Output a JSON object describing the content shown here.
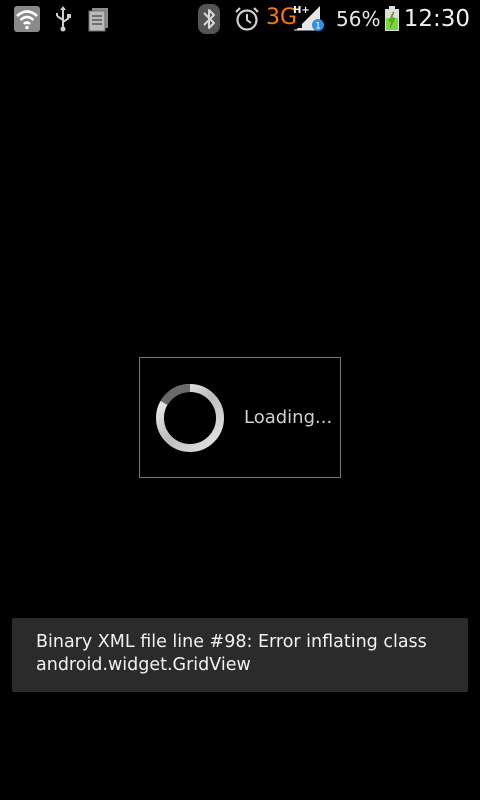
{
  "status_bar": {
    "icons_left": [
      "wifi-icon",
      "usb-icon",
      "notification-icon"
    ],
    "icons_right": [
      "bluetooth-icon",
      "alarm-icon",
      "signal-icon",
      "battery-icon"
    ],
    "network_type": "3G",
    "network_sub": "H+",
    "sim_slot": "1",
    "battery_percent": "56%",
    "battery_level": 0.56,
    "time": "12:30"
  },
  "dialog": {
    "loading_text": "Loading..."
  },
  "toast": {
    "line1": "Binary XML file line #98: Error inflating class",
    "line2": "android.widget.GridView"
  }
}
